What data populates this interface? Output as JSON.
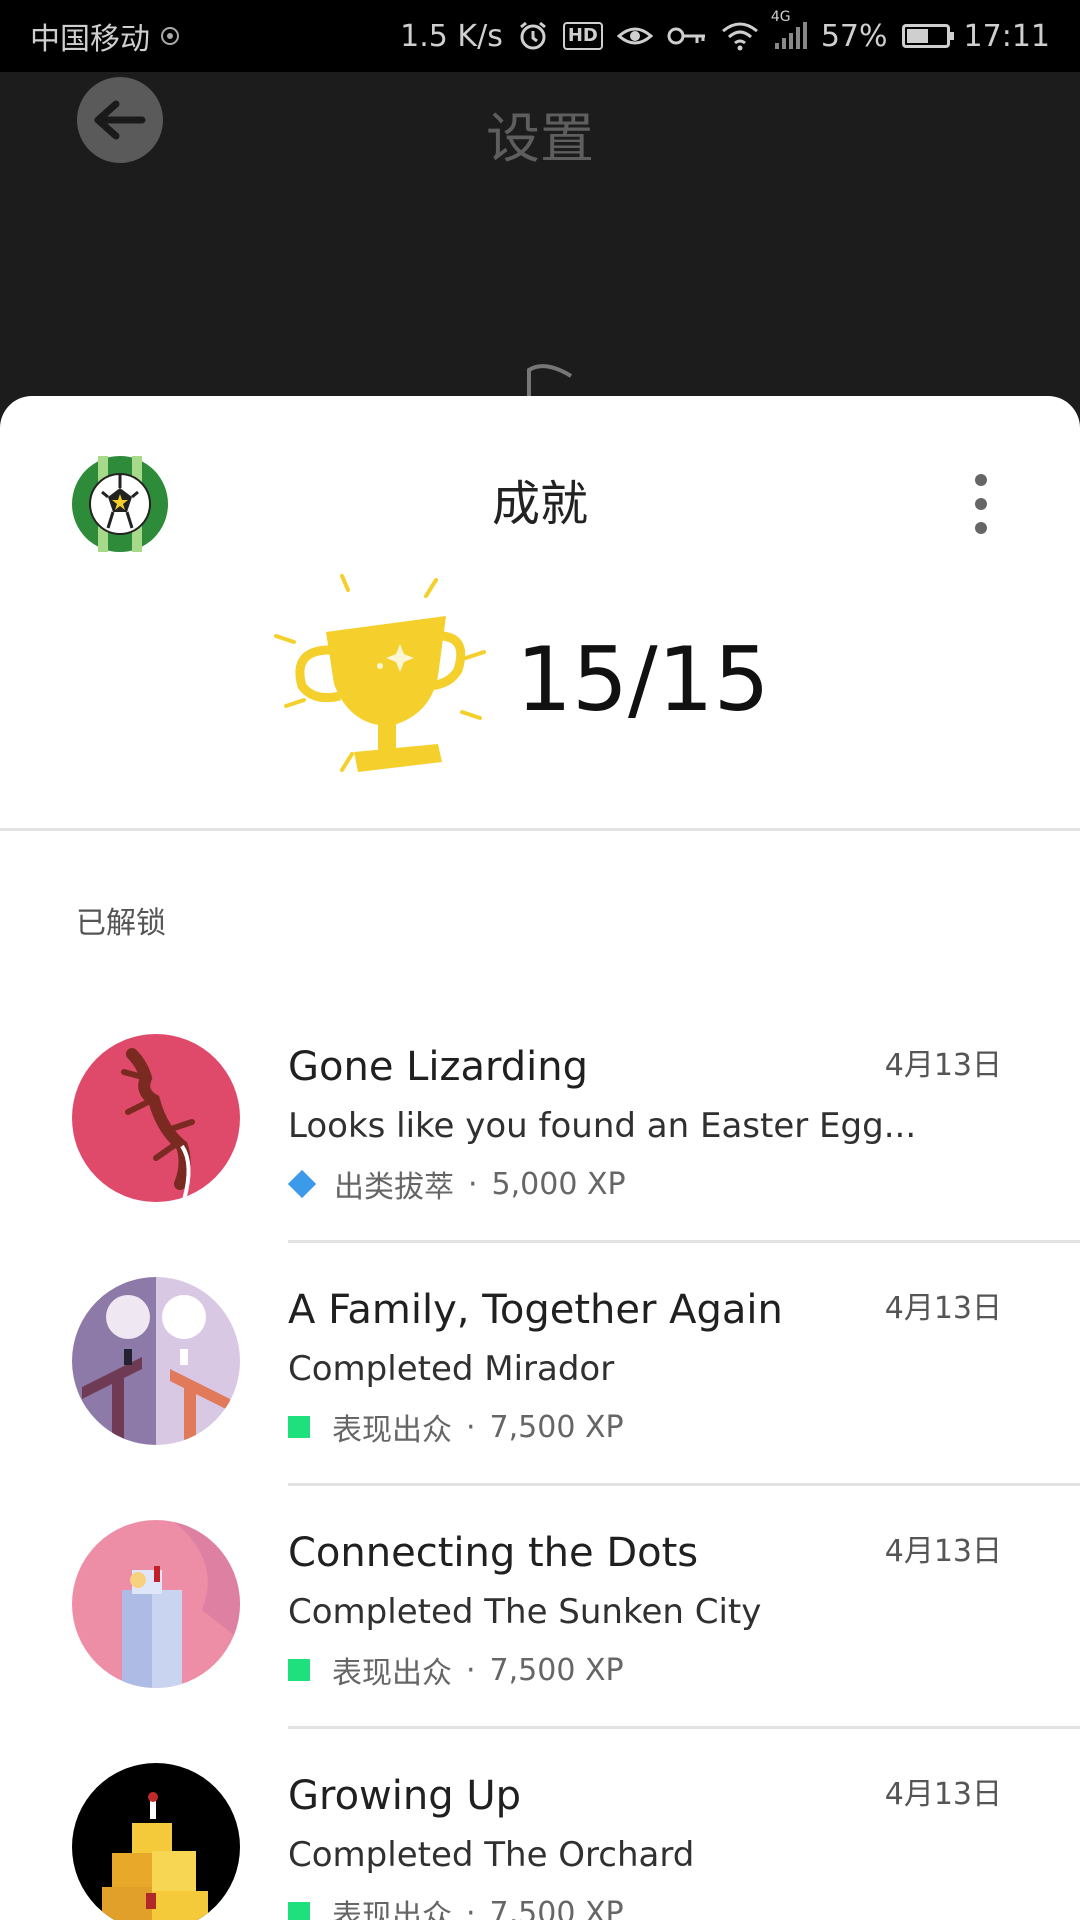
{
  "status_bar": {
    "carrier": "中国移动",
    "speed": "1.5 K/s",
    "hd": "HD",
    "network": "4G",
    "battery": "57%",
    "time": "17:11"
  },
  "topbar": {
    "title": "设置"
  },
  "sheet": {
    "title": "成就",
    "progress": "15/15",
    "section_label": "已解锁"
  },
  "achievements": [
    {
      "name": "Gone Lizarding",
      "date": "4月13日",
      "description": "Looks like you found an Easter Egg...",
      "rarity": "出类拔萃",
      "separator": "·",
      "xp": "5,000 XP"
    },
    {
      "name": "A Family, Together Again",
      "date": "4月13日",
      "description": "Completed Mirador",
      "rarity": "表现出众",
      "separator": "·",
      "xp": "7,500 XP"
    },
    {
      "name": "Connecting the Dots",
      "date": "4月13日",
      "description": "Completed The Sunken City",
      "rarity": "表现出众",
      "separator": "·",
      "xp": "7,500 XP"
    },
    {
      "name": "Growing Up",
      "date": "4月13日",
      "description": "Completed The Orchard",
      "rarity": "表现出众",
      "separator": "·",
      "xp": "7,500 XP"
    }
  ],
  "colors": {
    "rarity_rare": "#3b9be8",
    "rarity_uncommon": "#1ee07c",
    "trophy": "#f5cf2c"
  }
}
